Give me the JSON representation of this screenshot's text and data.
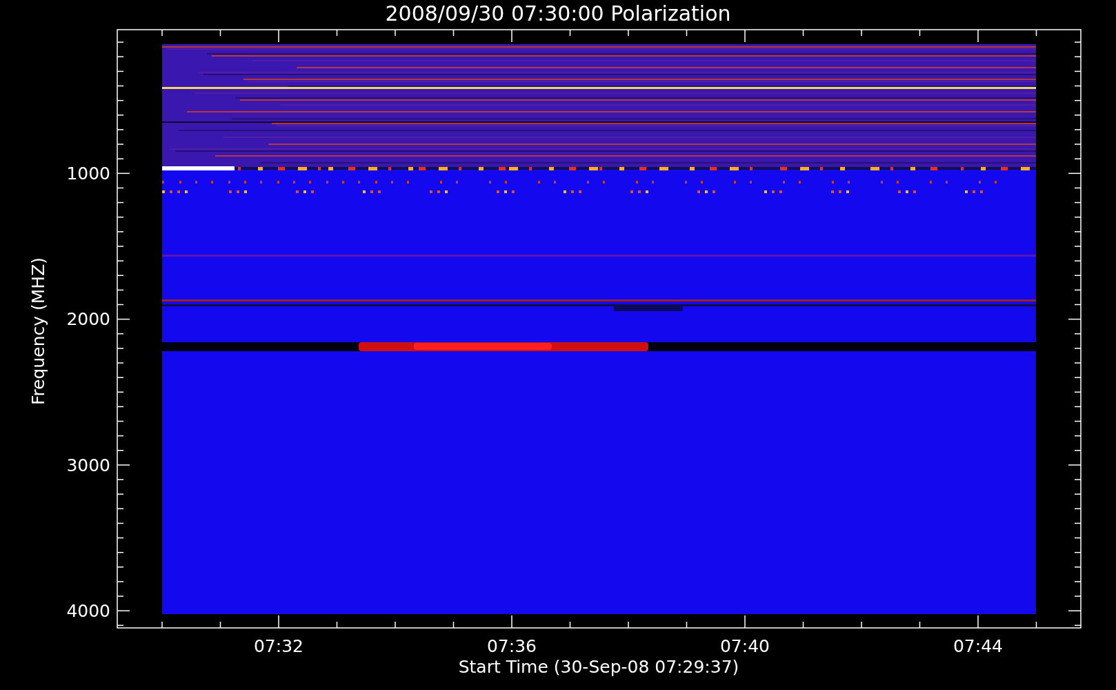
{
  "title": "2008/09/30 07:30:00 Polarization",
  "ylabel": "Frequency (MHZ)",
  "xlabel": "Start Time (30-Sep-08 07:29:37)",
  "yticks": [
    "1000",
    "2000",
    "3000",
    "4000"
  ],
  "xticks": [
    "07:32",
    "07:36",
    "07:40",
    "07:44"
  ]
}
